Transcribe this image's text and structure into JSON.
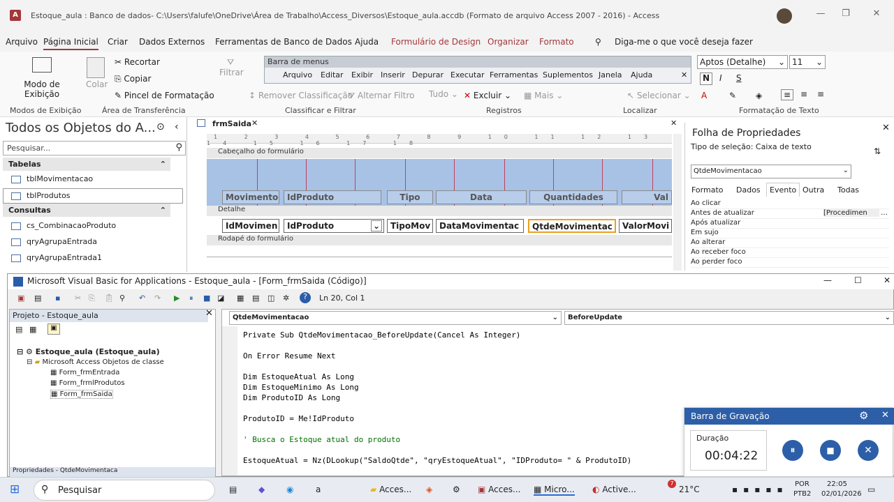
{
  "window": {
    "title": "Estoque_aula : Banco de dados- C:\\Users\\falufe\\OneDrive\\Área de Trabalho\\Access_Diversos\\Estoque_aula.accdb (Formato de arquivo Access 2007 - 2016)  -  Access"
  },
  "menu": [
    "Arquivo",
    "Página Inicial",
    "Criar",
    "Dados Externos",
    "Ferramentas de Banco de Dados",
    "Ajuda",
    "Formulário de Design",
    "Organizar",
    "Formato"
  ],
  "tellme": "Diga-me o que você deseja fazer",
  "ribbon": {
    "view_label": "Modo de Exibição",
    "paste_label": "Colar",
    "cut": "Recortar",
    "copy": "Copiar",
    "format_painter": "Pincel de Formatação",
    "filter": "Filtrar",
    "remove_sort": "Remover Classificação",
    "toggle_filter": "Alternar Filtro",
    "all_label": "Tudo",
    "delete": "Excluir",
    "more": "Mais",
    "select": "Selecionar",
    "font_name": "Aptos (Detalhe)",
    "font_size": "11",
    "groups": [
      "Modos de Exibição",
      "Área de Transferência",
      "Classificar e Filtrar",
      "Registros",
      "Localizar",
      "Formatação de Texto"
    ],
    "menubar_title": "Barra de menus",
    "menubar_items": [
      "Arquivo",
      "Editar",
      "Exibir",
      "Inserir",
      "Depurar",
      "Executar",
      "Ferramentas",
      "Suplementos",
      "Janela",
      "Ajuda"
    ]
  },
  "nav": {
    "title": "Todos os Objetos do A...",
    "search_placeholder": "Pesquisar...",
    "sections": [
      {
        "label": "Tabelas",
        "items": [
          "tblMovimentacao",
          "tblProdutos"
        ]
      },
      {
        "label": "Consultas",
        "items": [
          "cs_CombinacaoProduto",
          "qryAgrupaEntrada",
          "qryAgrupaEntrada1"
        ]
      }
    ]
  },
  "form": {
    "tab": "frmSaida",
    "header_band": "Cabeçalho do formulário",
    "detail_band": "Detalhe",
    "footer_band": "Rodapé do formulário",
    "header_labels": [
      "Movimento",
      "IdProduto",
      "Tipo",
      "Data",
      "Quantidades",
      "Val"
    ],
    "detail_fields": [
      "IdMovimen",
      "IdProduto",
      "TipoMov",
      "DataMovimentac",
      "QtdeMovimentac",
      "ValorMovi"
    ],
    "ruler": "1 2 3 4 5 6 7 8 9 10 11 12 13 14 15 16 17 18"
  },
  "props": {
    "title": "Folha de Propriedades",
    "selection_type": "Tipo de seleção:  Caixa de texto",
    "control": "QtdeMovimentacao",
    "tabs": [
      "Formato",
      "Dados",
      "Evento",
      "Outra",
      "Todas"
    ],
    "rows": [
      "Ao clicar",
      "Antes de atualizar",
      "Após atualizar",
      "Em sujo",
      "Ao alterar",
      "Ao receber foco",
      "Ao perder foco"
    ],
    "before_update_value": "[Procedimen"
  },
  "vba": {
    "title": "Microsoft Visual Basic for Applications - Estoque_aula - [Form_frmSaida (Código)]",
    "position": "Ln 20, Col 1",
    "project_title": "Projeto - Estoque_aula",
    "tree": [
      "Estoque_aula (Estoque_aula)",
      "Microsoft Access Objetos de classe",
      "Form_frmEntrada",
      "Form_frmlProdutos",
      "Form_frmSaida"
    ],
    "object_combo": "QtdeMovimentacao",
    "proc_combo": "BeforeUpdate",
    "code": [
      "Private Sub QtdeMovimentacao_BeforeUpdate(Cancel As Integer)",
      "On Error Resume Next",
      "Dim EstoqueAtual As Long",
      "Dim EstoqueMinimo As Long",
      "Dim ProdutoID As Long",
      "ProdutoID = Me!IdProduto",
      "' Busca o Estoque atual do produto",
      "EstoqueAtual = Nz(DLookup(\"SaldoQtde\", \"qryEstoqueAtual\", \"IDProduto= \" & ProdutoID)"
    ],
    "props_footer": "Propriedades - QtdeMovimentaca"
  },
  "recorder": {
    "title": "Barra de Gravação",
    "duration_label": "Duração",
    "duration": "00:04:22"
  },
  "taskbar": {
    "search": "Pesquisar",
    "apps": [
      "Acces...",
      "Acces...",
      "Micro...",
      "Active..."
    ],
    "temp": "21°C",
    "lang": "POR",
    "layout": "PTB2",
    "time": "22:05",
    "date": "02/01/2026",
    "badge": "7"
  },
  "colors": {
    "access": "#a4373a",
    "accent": "#2d5fa8",
    "header": "#a8c2e6",
    "grid": "#c04060"
  }
}
